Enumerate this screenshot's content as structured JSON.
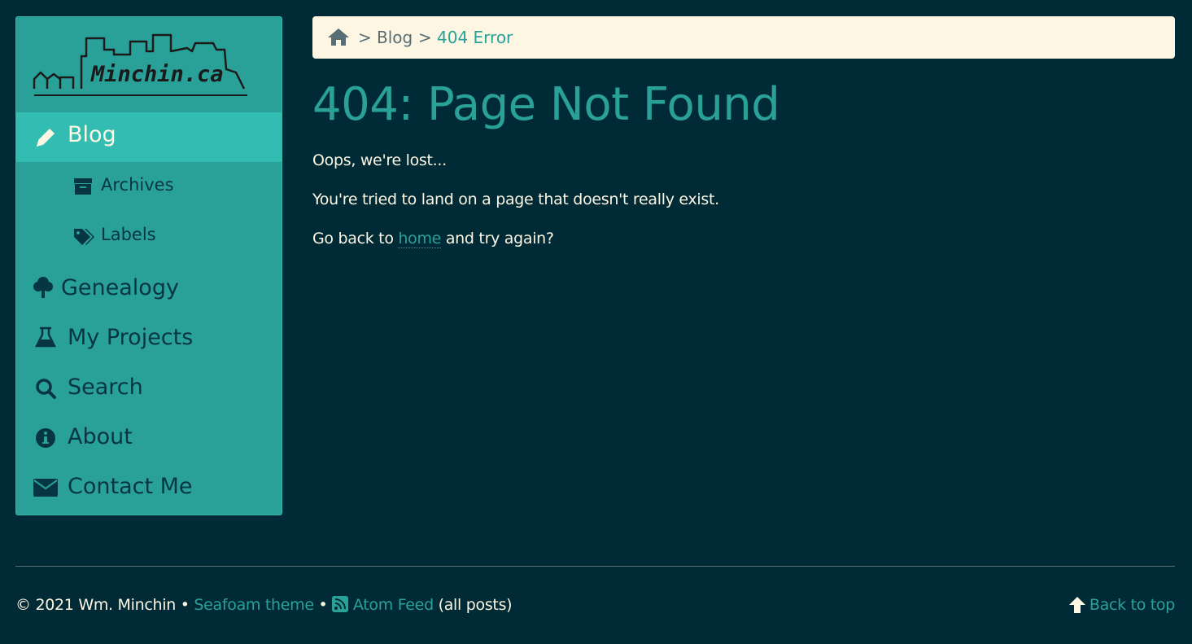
{
  "site": {
    "logo_text": "Minchin.ca"
  },
  "sidebar": {
    "items": [
      {
        "label": "Blog",
        "icon": "pencil-icon",
        "active": true
      },
      {
        "label": "Archives",
        "icon": "archive-icon"
      },
      {
        "label": "Labels",
        "icon": "tags-icon"
      },
      {
        "label": "Genealogy",
        "icon": "tree-icon"
      },
      {
        "label": "My Projects",
        "icon": "flask-icon"
      },
      {
        "label": "Search",
        "icon": "search-icon"
      },
      {
        "label": "About",
        "icon": "info-icon"
      },
      {
        "label": "Contact Me",
        "icon": "envelope-icon"
      }
    ]
  },
  "breadcrumb": {
    "sep": ">",
    "blog": "Blog",
    "current": "404 Error"
  },
  "main": {
    "title": "404: Page Not Found",
    "line1": "Oops, we're lost...",
    "line2": "You're tried to land on a page that doesn't really exist.",
    "line3_pre": "Go back to",
    "line3_link": "home",
    "line3_post": "and try again?"
  },
  "footer": {
    "copyright": "© 2021 Wm. Minchin",
    "bullet": "•",
    "theme_link": "Seafoam theme",
    "feed_link": "Atom Feed",
    "feed_note": "(all posts)",
    "back_to_top": "Back to top"
  },
  "colors": {
    "background": "#002b36",
    "accent": "#2aa198",
    "active": "#33bdb2",
    "breadcrumb_bg": "#fdf6e3"
  }
}
